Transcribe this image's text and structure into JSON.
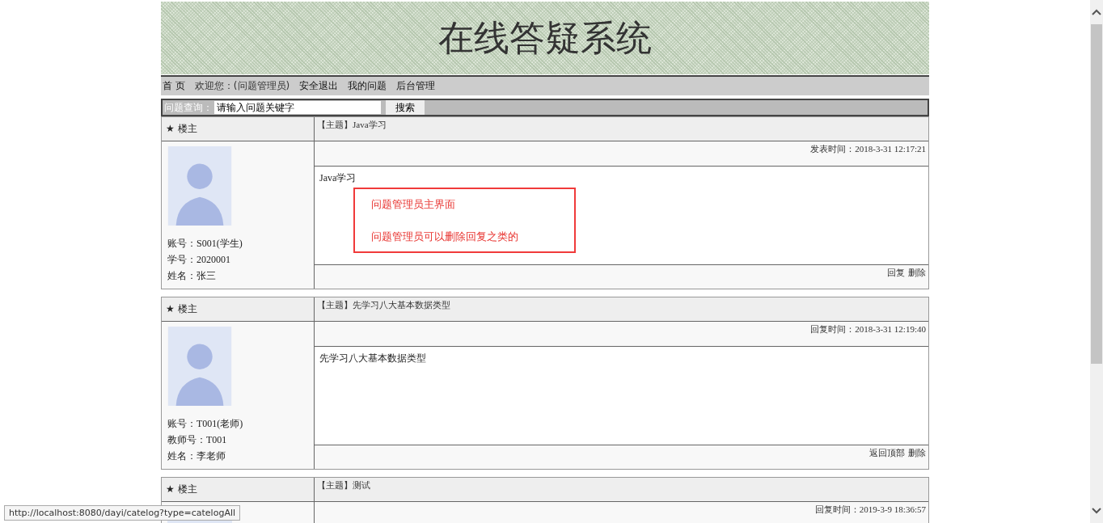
{
  "header": {
    "title": "在线答疑系统"
  },
  "nav": {
    "items": [
      {
        "label": "首 页",
        "kind": "link"
      },
      {
        "label": "欢迎您：(问题管理员)",
        "kind": "text"
      },
      {
        "label": "安全退出",
        "kind": "link"
      },
      {
        "label": "我的问题",
        "kind": "link"
      },
      {
        "label": "后台管理",
        "kind": "link"
      }
    ]
  },
  "search": {
    "label": "问题查询：",
    "value": "请输入问题关键字",
    "button": "搜索"
  },
  "posts": [
    {
      "role": "★ 楼主",
      "subject": "【主题】Java学习",
      "time": "发表时间：2018-3-31 12:17:21",
      "content": "Java学习",
      "info": [
        "账号：S001(学生)",
        "学号：2020001",
        "姓名：张三"
      ],
      "actions": [
        "回复",
        "删除"
      ]
    },
    {
      "role": "★ 楼主",
      "subject": "【主题】先学习八大基本数据类型",
      "time": "回复时间：2018-3-31 12:19:40",
      "content": "先学习八大基本数据类型",
      "info": [
        "账号：T001(老师)",
        "教师号：T001",
        "姓名：李老师"
      ],
      "actions": [
        "返回顶部",
        "删除"
      ]
    },
    {
      "role": "★ 楼主",
      "subject": "【主题】测试",
      "time": "回复时间：2019-3-9 18:36:57"
    }
  ],
  "annotation": {
    "lines": [
      "问题管理员主界面",
      "问题管理员可以删除回复之类的"
    ]
  },
  "status_bar": {
    "url": "http://localhost:8080/dayi/catelog?type=catelogAll"
  }
}
